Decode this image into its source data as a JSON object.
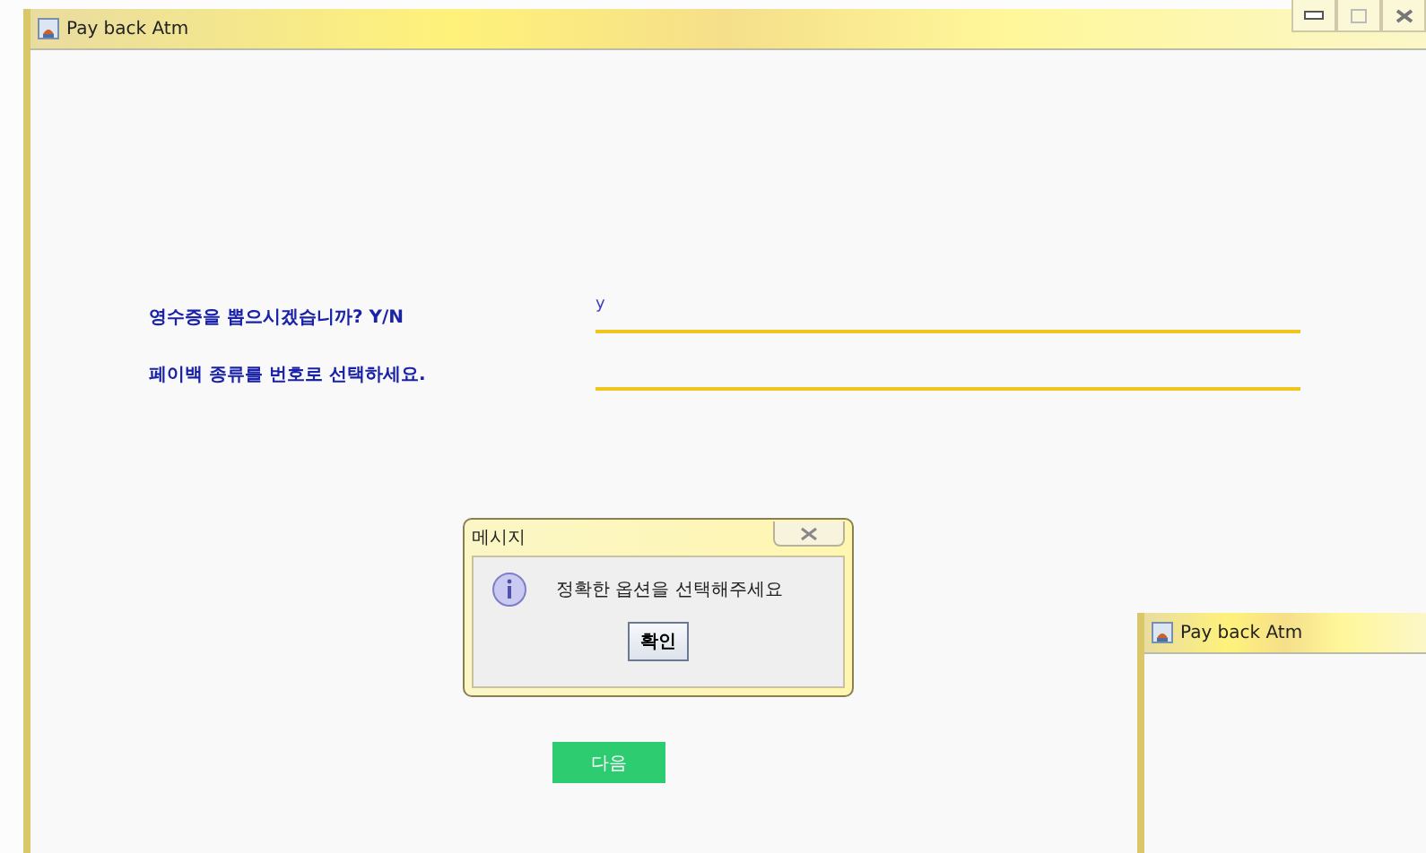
{
  "main_window": {
    "title": "Pay back Atm"
  },
  "form": {
    "fields": [
      {
        "label": "영수증을 뽑으시겠습니까? Y/N",
        "value": "y"
      },
      {
        "label": "페이백 종류를 번호로 선택하세요."
      }
    ]
  },
  "next_button": "다음",
  "dialog": {
    "title": "메시지",
    "message": "정확한 옵션을 선택해주세요",
    "ok_button": "확인"
  },
  "second_window": {
    "title": "Pay back Atm"
  }
}
